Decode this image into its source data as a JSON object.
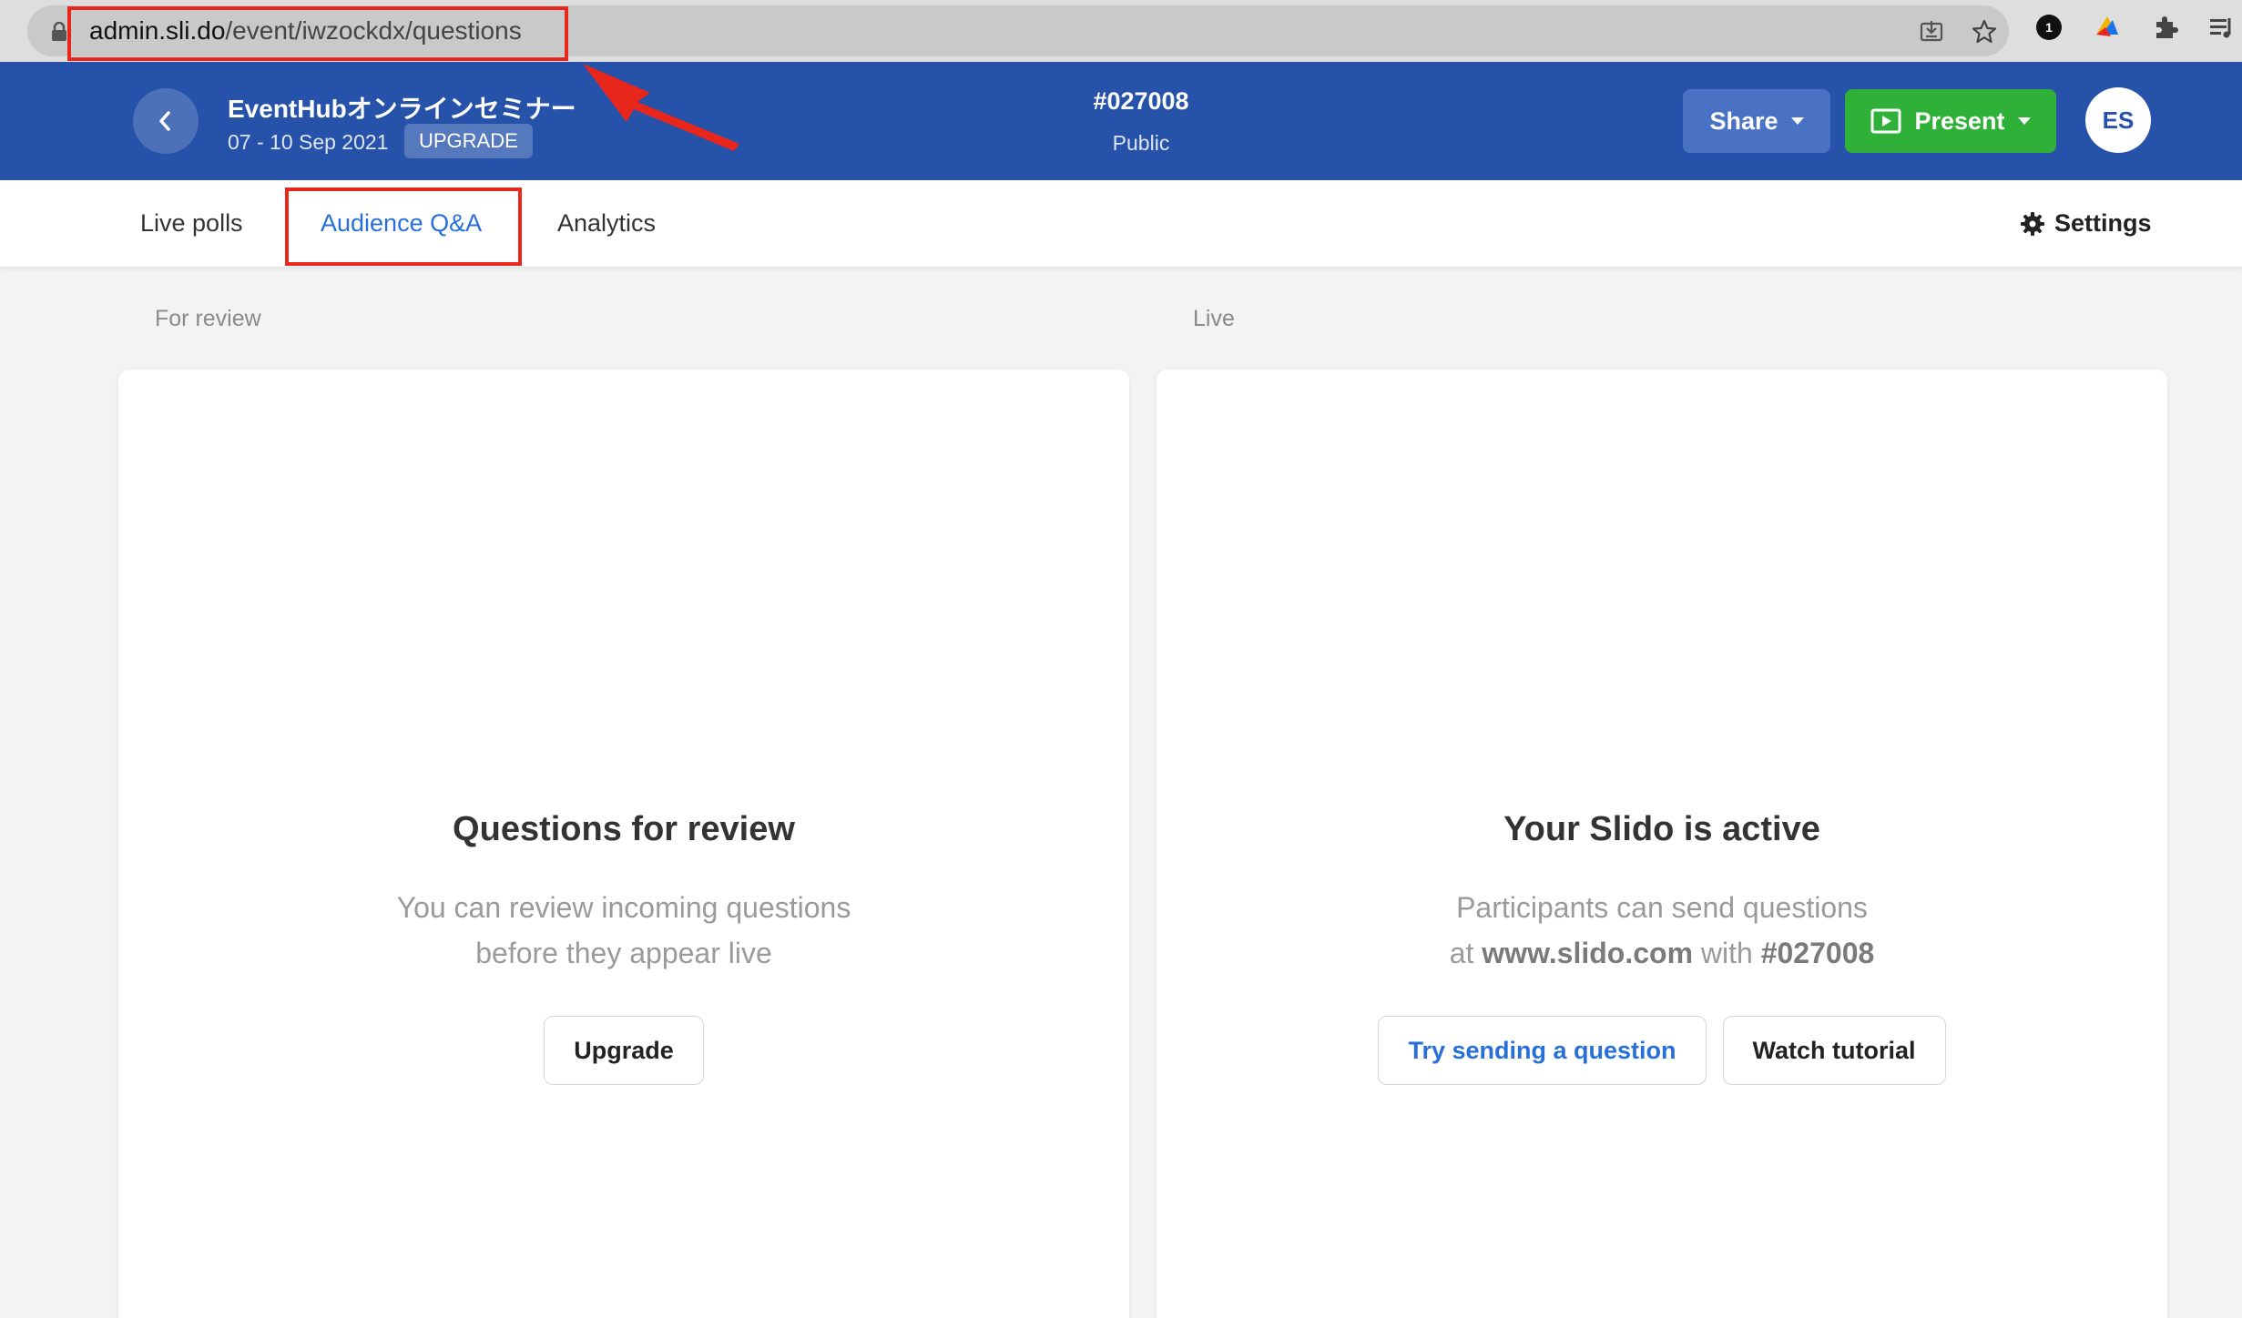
{
  "browser": {
    "url_host": "admin.sli.do",
    "url_path": "/event/iwzockdx/questions"
  },
  "header": {
    "event_title": "EventHubオンラインセミナー",
    "event_dates": "07 - 10 Sep 2021",
    "upgrade_badge": "UPGRADE",
    "event_code": "#027008",
    "event_visibility": "Public",
    "share_label": "Share",
    "present_label": "Present",
    "avatar_initials": "ES"
  },
  "tabs": {
    "items": [
      {
        "label": "Live polls"
      },
      {
        "label": "Audience Q&A",
        "active": true
      },
      {
        "label": "Analytics"
      }
    ],
    "settings_label": "Settings"
  },
  "columns": {
    "review": {
      "label": "For review",
      "title": "Questions for review",
      "desc_line1": "You can review incoming questions",
      "desc_line2": "before they appear live",
      "button_label": "Upgrade"
    },
    "live": {
      "label": "Live",
      "title": "Your Slido is active",
      "desc_line1": "Participants can send questions",
      "desc_at": "at",
      "desc_site": "www.slido.com",
      "desc_with": "with",
      "desc_code": "#027008",
      "try_button_label": "Try sending a question",
      "watch_button_label": "Watch tutorial"
    }
  },
  "colors": {
    "header_bg": "#2752aa",
    "present_green": "#2fb139",
    "active_tab_blue": "#2770d9",
    "annotation_red": "#e8261c"
  }
}
